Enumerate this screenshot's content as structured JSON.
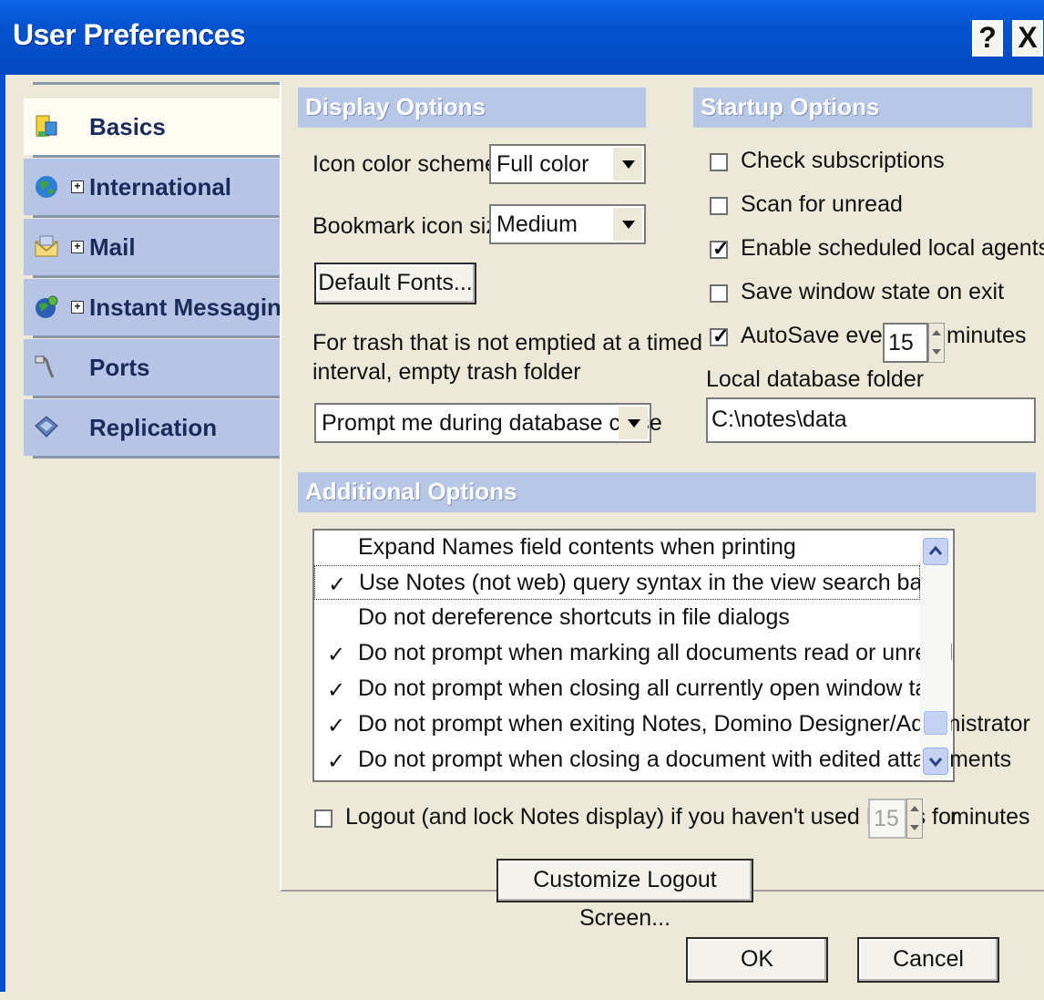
{
  "window": {
    "title": "User Preferences",
    "help_label": "?",
    "close_label": "X"
  },
  "sidebar": {
    "items": [
      {
        "label": "Basics",
        "icon": "basics-icon",
        "selected": true,
        "expandable": false
      },
      {
        "label": "International",
        "icon": "globe-icon",
        "selected": false,
        "expandable": true
      },
      {
        "label": "Mail",
        "icon": "mail-icon",
        "selected": false,
        "expandable": true
      },
      {
        "label": "Instant Messaging",
        "icon": "instant-messaging-icon",
        "selected": false,
        "expandable": true
      },
      {
        "label": "Ports",
        "icon": "ports-icon",
        "selected": false,
        "expandable": false
      },
      {
        "label": "Replication",
        "icon": "replication-icon",
        "selected": false,
        "expandable": false
      }
    ],
    "plus_symbol": "+"
  },
  "display_options": {
    "header": "Display Options",
    "icon_color_scheme": {
      "label": "Icon color scheme",
      "value": "Full color"
    },
    "bookmark_icon_size": {
      "label": "Bookmark icon size",
      "value": "Medium"
    },
    "default_fonts_button": "Default Fonts...",
    "trash_label_line1": "For trash that is not emptied at a timed",
    "trash_label_line2": "interval, empty trash folder",
    "trash_value": "Prompt me during database close"
  },
  "startup_options": {
    "header": "Startup Options",
    "check_subscriptions": {
      "label": "Check subscriptions",
      "checked": false
    },
    "scan_for_unread": {
      "label": "Scan for unread",
      "checked": false
    },
    "enable_scheduled_local_agents": {
      "label": "Enable scheduled local agents",
      "checked": true
    },
    "save_window_state": {
      "label": "Save window state on exit",
      "checked": false
    },
    "autosave": {
      "label": "AutoSave every",
      "checked": true,
      "value": "15",
      "suffix": "minutes"
    },
    "local_db_folder_label": "Local database folder",
    "local_db_folder_value": "C:\\notes\\data"
  },
  "additional_options": {
    "header": "Additional Options",
    "check_symbol": "✓",
    "items": [
      {
        "label": "Expand Names field contents when printing",
        "checked": false
      },
      {
        "label": "Use Notes (not web) query syntax in the view search bar",
        "checked": true
      },
      {
        "label": "Do not dereference shortcuts in file dialogs",
        "checked": false
      },
      {
        "label": "Do not prompt when marking all documents read or unread",
        "checked": true
      },
      {
        "label": "Do not prompt when closing all currently open window tabs",
        "checked": true
      },
      {
        "label": "Do not prompt when exiting Notes, Domino Designer/Administrator",
        "checked": true
      },
      {
        "label": "Do not prompt when closing a document with edited attachments",
        "checked": true
      }
    ]
  },
  "logout": {
    "label": "Logout (and lock Notes display) if you haven't used Notes for",
    "checked": false,
    "value": "15",
    "suffix": "minutes",
    "customize_button": "Customize Logout Screen..."
  },
  "footer": {
    "ok_label": "OK",
    "cancel_label": "Cancel"
  }
}
